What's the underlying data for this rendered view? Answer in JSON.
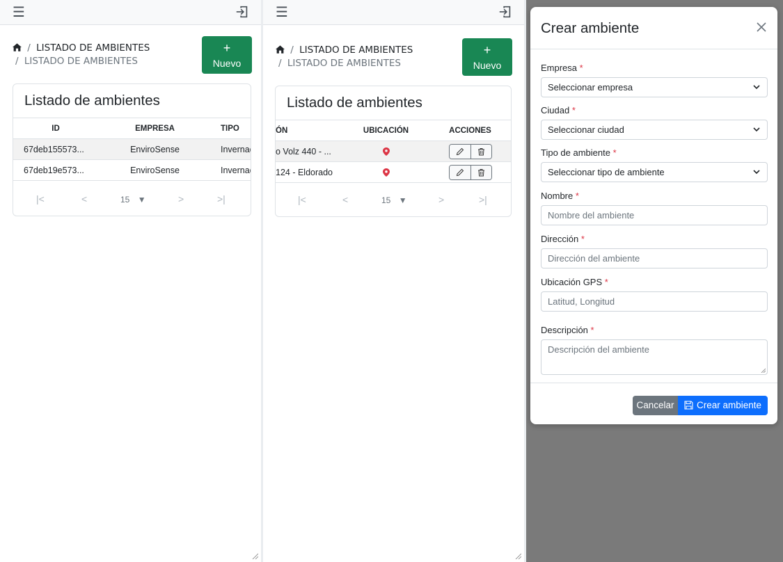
{
  "topbar": {
    "menu_icon": "hamburger-icon",
    "logout_icon": "logout-icon"
  },
  "breadcrumb": {
    "home_icon": "home-icon",
    "sep": "/",
    "item1": "LISTADO DE AMBIENTES",
    "item2": "LISTADO DE AMBIENTES"
  },
  "new_button": {
    "icon": "+",
    "label": "Nuevo"
  },
  "card": {
    "title": "Listado de ambientes"
  },
  "table_left": {
    "columns": [
      "ID",
      "EMPRESA",
      "TIPO"
    ],
    "rows": [
      {
        "id": "67deb155573...",
        "empresa": "EnviroSense",
        "tipo": "Invernad"
      },
      {
        "id": "67deb19e573...",
        "empresa": "EnviroSense",
        "tipo": "Invernad"
      }
    ]
  },
  "table_right": {
    "columns": [
      "ÓN",
      "UBICACIÓN",
      "ACCIONES"
    ],
    "rows": [
      {
        "direccion": "o Volz 440 - ..."
      },
      {
        "direccion": "124 - Eldorado"
      }
    ]
  },
  "pager": {
    "first": "|<",
    "prev": "<",
    "page_size": "15",
    "next": ">",
    "last": ">|"
  },
  "modal": {
    "title": "Crear ambiente",
    "required_mark": "*",
    "fields": {
      "empresa": {
        "label": "Empresa",
        "value": "Seleccionar empresa"
      },
      "ciudad": {
        "label": "Ciudad",
        "value": "Seleccionar ciudad"
      },
      "tipo": {
        "label": "Tipo de ambiente",
        "value": "Seleccionar tipo de ambiente"
      },
      "nombre": {
        "label": "Nombre",
        "placeholder": "Nombre del ambiente"
      },
      "direccion": {
        "label": "Dirección",
        "placeholder": "Dirección del ambiente"
      },
      "gps": {
        "label": "Ubicación GPS",
        "placeholder": "Latitud, Longitud"
      },
      "descripcion": {
        "label": "Descripción",
        "placeholder": "Descripción del ambiente"
      }
    },
    "cancel_label": "Cancelar",
    "create_label": "Crear ambiente"
  },
  "colors": {
    "primary": "#0d6efd",
    "success": "#198754",
    "secondary": "#6c757d",
    "danger": "#dc3545",
    "overlay": "#7a7a7a"
  }
}
